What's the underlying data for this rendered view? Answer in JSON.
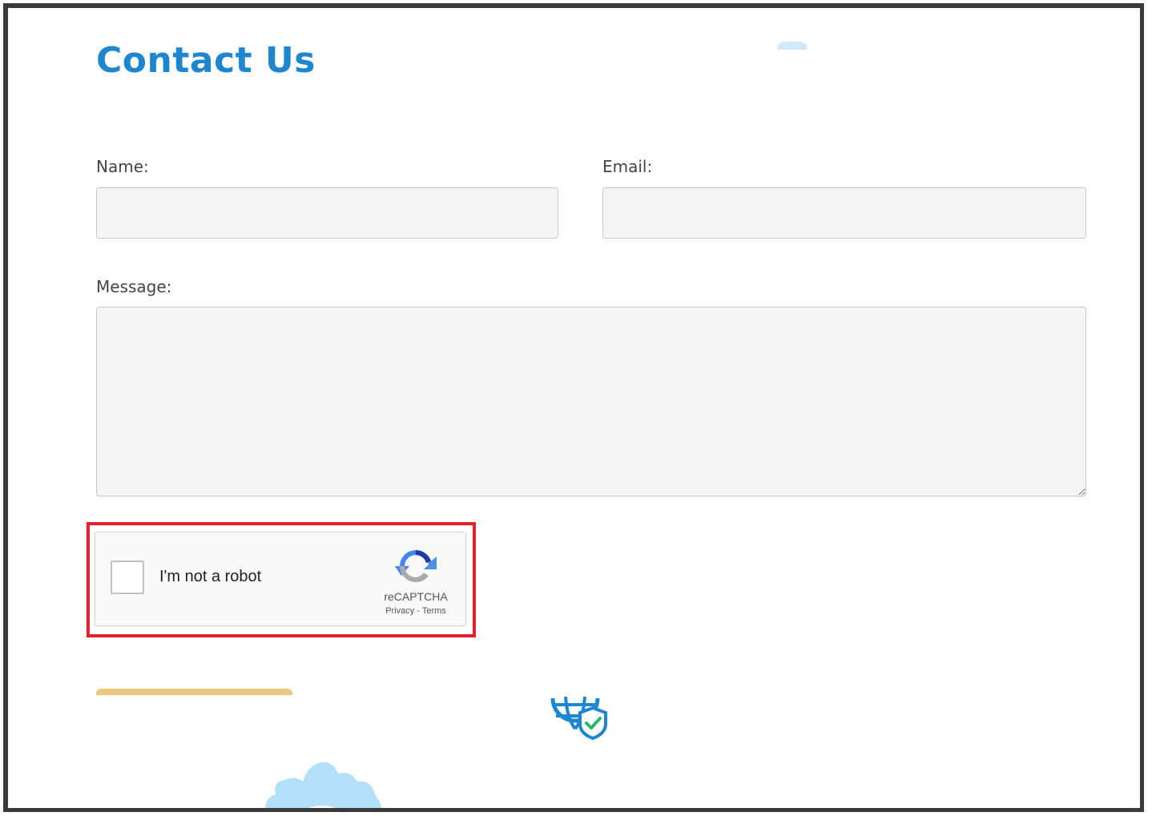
{
  "page": {
    "title": "Contact Us"
  },
  "form": {
    "name_label": "Name:",
    "name_value": "",
    "email_label": "Email:",
    "email_value": "",
    "message_label": "Message:",
    "message_value": ""
  },
  "captcha": {
    "checkbox_label": "I'm not a robot",
    "checked": false,
    "brand": "reCAPTCHA",
    "privacy_label": "Privacy",
    "separator": " - ",
    "terms_label": "Terms"
  },
  "colors": {
    "title": "#1e86d0",
    "highlight": "#e5202e",
    "submit_button": "#ecc87e",
    "decoration": "#b3dff9"
  },
  "icons": [
    "recaptcha-logo-icon",
    "globe-shield-icon",
    "gear-icon"
  ]
}
